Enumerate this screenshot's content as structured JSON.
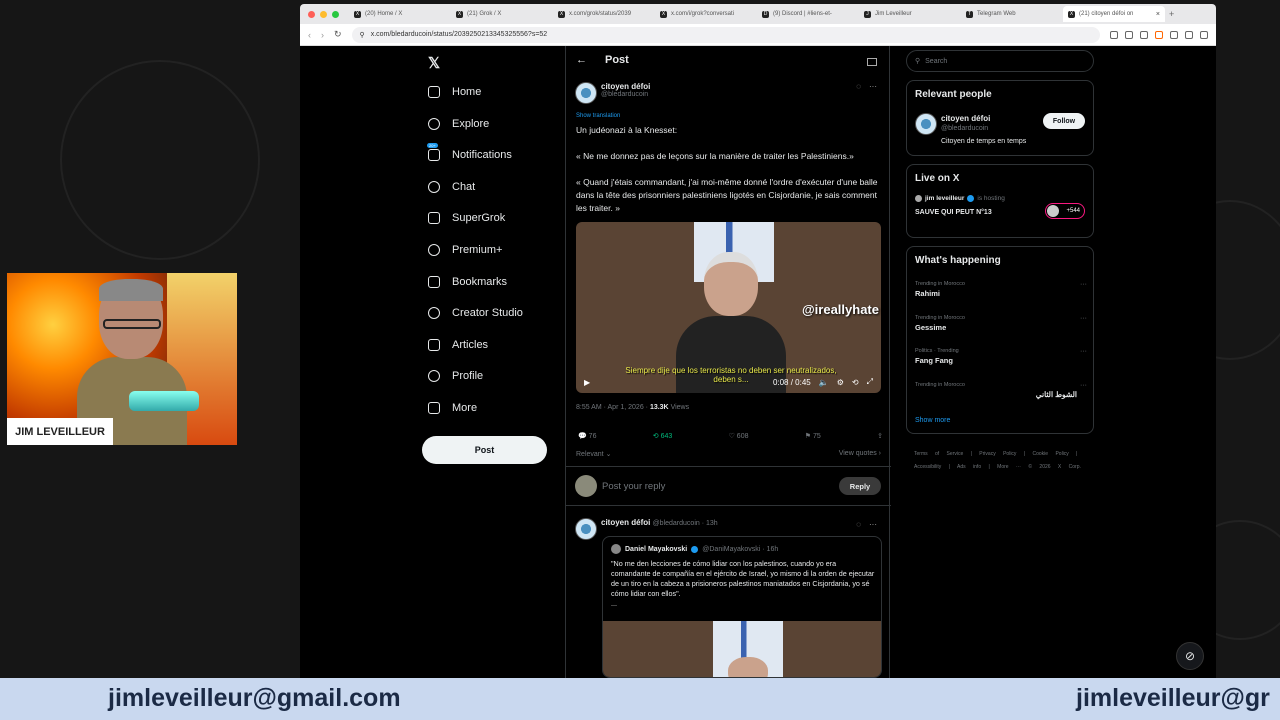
{
  "browser": {
    "tabs": [
      {
        "label": "(20) Home / X",
        "fav": "X"
      },
      {
        "label": "(21) Grok / X",
        "fav": "X"
      },
      {
        "label": "x.com/grok/status/2039",
        "fav": "X"
      },
      {
        "label": "x.com/i/grok?conversati",
        "fav": "X"
      },
      {
        "label": "(9) Discord | #liens-et-",
        "fav": "D"
      },
      {
        "label": "Jim Leveilleur",
        "fav": "J"
      },
      {
        "label": "Telegram Web",
        "fav": "T"
      },
      {
        "label": "(21) citoyen défoi on",
        "fav": "X",
        "active": true
      }
    ],
    "url": "x.com/bledarducoin/status/2039250213345325556?s=52"
  },
  "nav": {
    "items": [
      {
        "label": "Home",
        "icon": "home-icon"
      },
      {
        "label": "Explore",
        "icon": "search-icon"
      },
      {
        "label": "Notifications",
        "icon": "bell-icon",
        "badge": "20+"
      },
      {
        "label": "Chat",
        "icon": "chat-icon"
      },
      {
        "label": "SuperGrok",
        "icon": "grok-icon"
      },
      {
        "label": "Premium+",
        "icon": "premium-icon"
      },
      {
        "label": "Bookmarks",
        "icon": "bookmark-icon"
      },
      {
        "label": "Creator Studio",
        "icon": "rocket-icon"
      },
      {
        "label": "Articles",
        "icon": "article-icon"
      },
      {
        "label": "Profile",
        "icon": "profile-icon"
      },
      {
        "label": "More",
        "icon": "more-icon"
      }
    ],
    "post_label": "Post"
  },
  "post": {
    "header": "Post",
    "author_name": "citoyen défoi",
    "author_handle": "@bledarducoin",
    "show_translation": "Show translation",
    "line1": "Un judéonazi à la Knesset:",
    "line2": "« Ne me donnez pas de leçons sur la manière de traiter les Palestiniens.»",
    "line3": "« Quand j'étais commandant, j'ai moi-même donné l'ordre d'exécuter d'une balle dans la tête des prisonniers palestiniens ligotés en Cisjordanie, je sais comment les traiter. »",
    "video": {
      "watermark": "@ireallyhate",
      "subtitle": "Siempre dije que los terroristas no deben ser neutralizados, deben s...",
      "time": "0:08 / 0:45"
    },
    "timestamp": "8:55 AM · Apr 1, 2026 · ",
    "views_count": "13.3K",
    "views_label": " Views",
    "replies": "76",
    "reposts": "643",
    "likes": "608",
    "bookmarks": "75",
    "relevant": "Relevant ⌄",
    "view_quotes": "View quotes ›",
    "reply_placeholder": "Post your reply",
    "reply_button": "Reply"
  },
  "reply": {
    "author_name": "citoyen défoi",
    "author_meta": "@bledarducoin · 13h",
    "quote": {
      "name": "Daniel Mayakovski",
      "meta": "@DaniMayakovski · 16h",
      "text": "\"No me den lecciones de cómo lidiar con los palestinos, cuando yo era comandante de compañía en el ejército de Israel, yo mismo di la orden de ejecutar de un tiro en la cabeza a prisioneros palestinos maniatados en Cisjordania, yo sé cómo lidiar con ellos\".",
      "ellipsis": "..."
    }
  },
  "sidebar": {
    "search_placeholder": "Search",
    "relevant_title": "Relevant people",
    "rp_name": "citoyen défoi",
    "rp_handle": "@bledarducoin",
    "rp_bio": "Citoyen de temps en temps",
    "follow": "Follow",
    "live_title": "Live on X",
    "live_host": "jim leveilleur",
    "live_is_hosting": "is hosting",
    "live_space": "SAUVE QUI PEUT N°13",
    "live_count": "+544",
    "happening_title": "What's happening",
    "trends": [
      {
        "context": "Trending in Morocco",
        "name": "Rahimi"
      },
      {
        "context": "Trending in Morocco",
        "name": "Gessime"
      },
      {
        "context": "Politics · Trending",
        "name": "Fang Fang"
      },
      {
        "context": "Trending in Morocco",
        "name": "الشوط الثاني",
        "rtl": true
      }
    ],
    "show_more": "Show more",
    "footer": "Terms of Service | Privacy Policy | Cookie Policy | Accessibility | Ads info | More ··· © 2026 X Corp."
  },
  "stream": {
    "cam_label": "JIM LEVEILLEUR",
    "email": "jimleveilleur@gmail.com",
    "email_repeat": "jimleveilleur@gr"
  },
  "colors": {
    "accent": "#1d9bf0",
    "repost": "#00ba7c",
    "banner": "#c9d8ef"
  }
}
